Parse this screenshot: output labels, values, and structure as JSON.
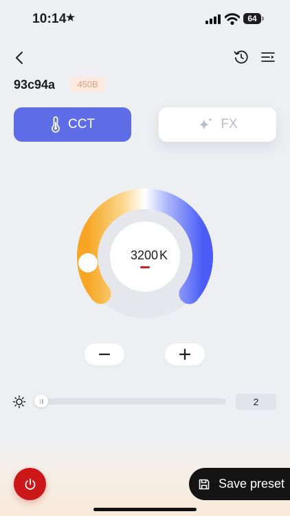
{
  "status_bar": {
    "time": "10:14",
    "battery": "64"
  },
  "nav": {
    "back_icon": "chevron-left-icon",
    "history_icon": "history-icon",
    "menu_icon": "menu-icon"
  },
  "device": {
    "name": "93c94a",
    "model": "450B"
  },
  "tabs": [
    {
      "label": "CCT",
      "icon": "thermometer-icon",
      "active": true
    },
    {
      "label": "FX",
      "icon": "sparkle-icon",
      "active": false
    }
  ],
  "cct": {
    "value": "3200",
    "unit": "K"
  },
  "brightness": {
    "value": "2",
    "level": 0.02
  },
  "actions": {
    "save_label": "Save preset",
    "power_icon": "power-icon"
  },
  "colors": {
    "accent": "#5e6de6",
    "power": "#cc1818",
    "warm": "#f6a623",
    "cool": "#4a5cf5"
  }
}
